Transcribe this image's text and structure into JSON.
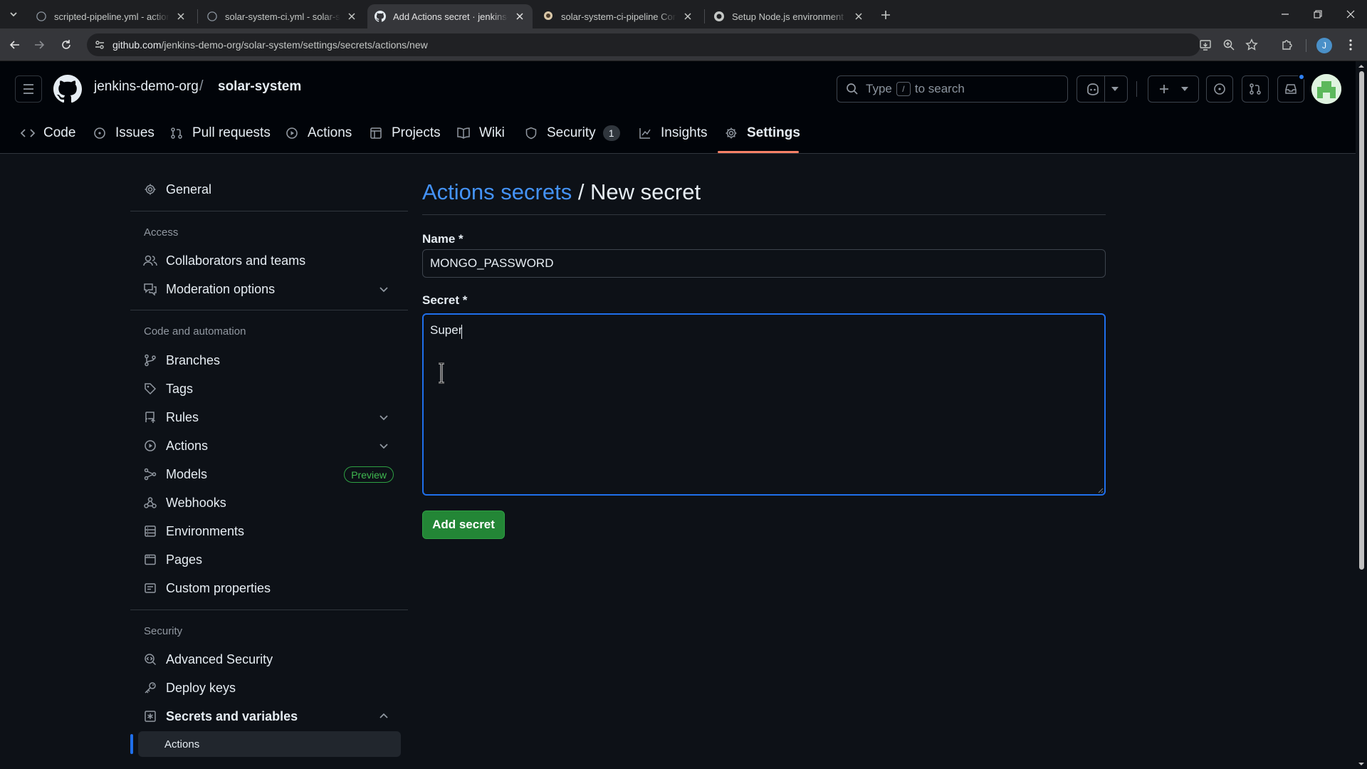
{
  "browser": {
    "tabs": [
      {
        "title": "scripted-pipeline.yml - actions-",
        "active": false
      },
      {
        "title": "solar-system-ci.yml - solar-syst",
        "active": false
      },
      {
        "title": "Add Actions secret · jenkins-de",
        "active": true
      },
      {
        "title": "solar-system-ci-pipeline Config",
        "active": false
      },
      {
        "title": "Setup Node.js environment · Ac",
        "active": false
      }
    ],
    "url_host": "github.com",
    "url_path": "/jenkins-demo-org/solar-system/settings/secrets/actions/new",
    "profile_initial": "J"
  },
  "header": {
    "owner": "jenkins-demo-org",
    "separator": "/",
    "repo": "solar-system",
    "search_prefix": "Type",
    "search_key": "/",
    "search_suffix": "to search"
  },
  "repo_nav": {
    "code": "Code",
    "issues": "Issues",
    "pull_requests": "Pull requests",
    "actions": "Actions",
    "projects": "Projects",
    "wiki": "Wiki",
    "security": "Security",
    "security_count": "1",
    "insights": "Insights",
    "settings": "Settings"
  },
  "sidebar": {
    "general": "General",
    "access_heading": "Access",
    "collaborators": "Collaborators and teams",
    "moderation": "Moderation options",
    "code_heading": "Code and automation",
    "branches": "Branches",
    "tags": "Tags",
    "rules": "Rules",
    "actions": "Actions",
    "models": "Models",
    "models_badge": "Preview",
    "webhooks": "Webhooks",
    "environments": "Environments",
    "pages": "Pages",
    "custom_properties": "Custom properties",
    "security_heading": "Security",
    "advanced_security": "Advanced Security",
    "deploy_keys": "Deploy keys",
    "secrets_variables": "Secrets and variables",
    "secrets_actions": "Actions"
  },
  "main": {
    "title_link": "Actions secrets",
    "title_sep": " / ",
    "title_rest": "New secret",
    "name_label": "Name *",
    "name_value": "MONGO_PASSWORD",
    "secret_label": "Secret *",
    "secret_value": "Super",
    "submit_label": "Add secret"
  },
  "colors": {
    "accent": "#4493f8",
    "primary_button": "#238636",
    "focus_border": "#1f6feb",
    "selected_tab_underline": "#f78166"
  }
}
